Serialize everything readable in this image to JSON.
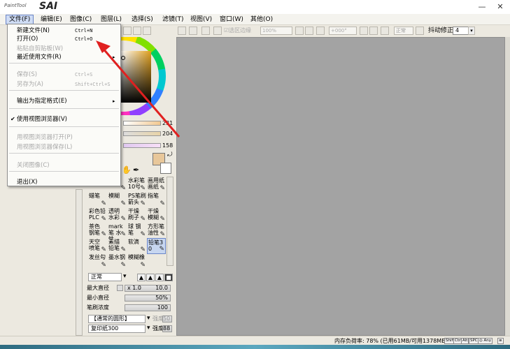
{
  "app": {
    "logo_small": "PaintTool",
    "logo_big": "SAI",
    "minimize_glyph": "—",
    "close_glyph": "✕"
  },
  "menubar": {
    "items": [
      {
        "label": "文件(F)"
      },
      {
        "label": "编辑(E)"
      },
      {
        "label": "图像(C)"
      },
      {
        "label": "图层(L)"
      },
      {
        "label": "选择(S)"
      },
      {
        "label": "滤镜(T)"
      },
      {
        "label": "视图(V)"
      },
      {
        "label": "窗口(W)"
      },
      {
        "label": "其他(O)"
      }
    ]
  },
  "toolbar": {
    "selection_edge_label": "选区边缘",
    "zoom_value": "100%",
    "angle_value": "+000°",
    "mode_value": "正常",
    "stabilizer_label": "抖动修正",
    "stabilizer_value": "4"
  },
  "file_menu": {
    "items": [
      {
        "label": "新建文件(N)",
        "shortcut": "Ctrl+N",
        "disabled": false
      },
      {
        "label": "打开(O)",
        "shortcut": "Ctrl+O",
        "disabled": false
      },
      {
        "label": "粘贴自剪贴板(W)",
        "shortcut": "",
        "disabled": true
      },
      {
        "label": "最近使用文件(R)",
        "shortcut": "",
        "disabled": false,
        "submenu": true
      },
      {
        "label": "保存(S)",
        "shortcut": "Ctrl+S",
        "disabled": true
      },
      {
        "label": "另存为(A)",
        "shortcut": "Shift+Ctrl+S",
        "disabled": true
      },
      {
        "label": "输出为指定格式(E)",
        "shortcut": "",
        "disabled": false,
        "submenu": true
      },
      {
        "label": "使用视图浏览器(V)",
        "shortcut": "",
        "disabled": false,
        "checked": true
      },
      {
        "label": "用视图浏览器打开(P)",
        "shortcut": "",
        "disabled": true
      },
      {
        "label": "用视图浏览器保存(L)",
        "shortcut": "",
        "disabled": true
      },
      {
        "label": "关闭图像(C)",
        "shortcut": "",
        "disabled": true
      },
      {
        "label": "退出(X)",
        "shortcut": "",
        "disabled": false
      }
    ],
    "submenu_arrow": "▸",
    "check_glyph": "✔"
  },
  "color": {
    "slider_values": [
      "231",
      "204",
      "158"
    ],
    "foreground": "#e8c79a",
    "background": "#ffffff"
  },
  "brushes": {
    "cells": [
      {
        "label": "",
        "icon": "✎"
      },
      {
        "label": "水彩笔 10号",
        "icon": "✎"
      },
      {
        "label": "画用纸 画纸",
        "icon": "✎"
      },
      {
        "label": "蜡笔",
        "icon": "✎"
      },
      {
        "label": "模糊",
        "icon": "✎"
      },
      {
        "label": "PS笔刷 箭头",
        "icon": "✎"
      },
      {
        "label": "指笔",
        "icon": "✎"
      },
      {
        "label": "彩色铅 PLC",
        "icon": "✎"
      },
      {
        "label": "透明 水彩",
        "icon": "✎"
      },
      {
        "label": "干燥 刷子",
        "icon": "✎"
      },
      {
        "label": "干燥 模糊",
        "icon": "✎"
      },
      {
        "label": "茶色 钢笔",
        "icon": "✎"
      },
      {
        "label": "mark笔 水性",
        "icon": "✎"
      },
      {
        "label": "球 钢笔",
        "icon": "✎"
      },
      {
        "label": "方形笔 油性",
        "icon": "✎"
      },
      {
        "label": "天空 喷笔",
        "icon": "✎"
      },
      {
        "label": "素描 铅笔",
        "icon": "✎"
      },
      {
        "label": "软滴",
        "icon": "✎"
      },
      {
        "label": "铅笔30",
        "icon": "✎"
      },
      {
        "label": "发丝勾",
        "icon": "✎"
      },
      {
        "label": "墨水钢",
        "icon": "✎"
      },
      {
        "label": "模糊橡",
        "icon": "✎"
      }
    ]
  },
  "brush_settings": {
    "blend_mode": "正常",
    "max_size_label": "最大直径",
    "max_size_mult": "x 1.0",
    "max_size_value": "10.0",
    "min_size_label": "最小直径",
    "min_size_value": "50%",
    "density_label": "笔刷浓度",
    "density_value": "100",
    "shape_value": "【通常的圆形】",
    "shape_strength_label": "强度",
    "shape_strength_value": "50",
    "texture_value": "复印纸300",
    "texture_strength_label": "强度",
    "texture_strength_value": "88"
  },
  "status": {
    "memory_text": "内存负荷率: 78% (已用61MB/可用1378MB)",
    "keys": [
      "Shift",
      "Ctrl",
      "Alt",
      "SPC",
      "◎ Any",
      "≡"
    ]
  }
}
